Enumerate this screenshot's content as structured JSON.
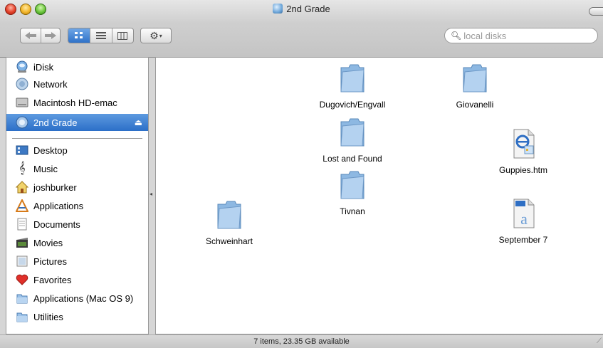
{
  "window": {
    "title": "2nd Grade",
    "status": "7 items, 23.35 GB available"
  },
  "toolbar": {
    "back_icon": "left-arrow-icon",
    "forward_icon": "right-arrow-icon",
    "view_icons": "icon-view-icon",
    "view_list": "list-view-icon",
    "view_columns": "column-view-icon",
    "action_icon": "gear-icon",
    "search_placeholder": "local disks"
  },
  "sidebar": {
    "devices": [
      {
        "label": "iDisk",
        "icon": "idisk-icon"
      },
      {
        "label": "Network",
        "icon": "network-icon"
      },
      {
        "label": "Macintosh HD-emac",
        "icon": "hard-disk-icon"
      },
      {
        "label": "2nd Grade",
        "icon": "server-volume-icon",
        "selected": true
      }
    ],
    "places": [
      {
        "label": "Desktop",
        "icon": "desktop-icon"
      },
      {
        "label": "Music",
        "icon": "music-icon"
      },
      {
        "label": "joshburker",
        "icon": "home-icon"
      },
      {
        "label": "Applications",
        "icon": "applications-icon"
      },
      {
        "label": "Documents",
        "icon": "documents-icon"
      },
      {
        "label": "Movies",
        "icon": "movies-icon"
      },
      {
        "label": "Pictures",
        "icon": "pictures-icon"
      },
      {
        "label": "Favorites",
        "icon": "heart-icon"
      },
      {
        "label": "Applications (Mac OS 9)",
        "icon": "folder-icon"
      },
      {
        "label": "Utilities",
        "icon": "folder-icon"
      }
    ]
  },
  "files": [
    {
      "name": "Dugovich/Engvall",
      "type": "folder"
    },
    {
      "name": "Giovanelli",
      "type": "folder"
    },
    {
      "name": "Lost and Found",
      "type": "folder"
    },
    {
      "name": "Guppies.htm",
      "type": "html-document"
    },
    {
      "name": "Tivnan",
      "type": "folder"
    },
    {
      "name": "Schweinhart",
      "type": "folder"
    },
    {
      "name": "September 7",
      "type": "word-document"
    }
  ]
}
